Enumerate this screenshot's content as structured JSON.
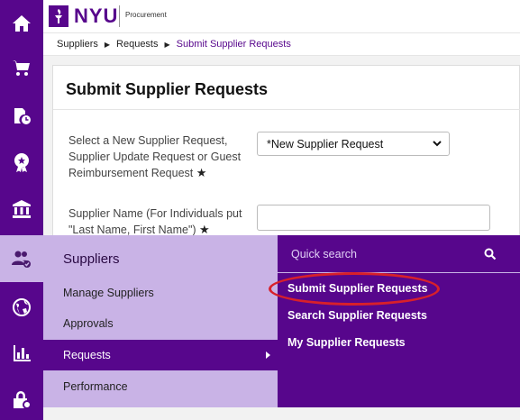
{
  "header": {
    "logo_text": "NYU",
    "app_name": "Procurement"
  },
  "breadcrumb": {
    "items": [
      "Suppliers",
      "Requests",
      "Submit Supplier Requests"
    ]
  },
  "page": {
    "title": "Submit Supplier Requests",
    "fields": [
      {
        "label_lines": [
          "Select a New Supplier Request,",
          "Supplier Update Request or Guest",
          "Reimbursement Request"
        ],
        "required_mark": "★",
        "control": "select",
        "value": "*New Supplier Request"
      },
      {
        "label_lines": [
          "Supplier Name (For Individuals put",
          "\"Last Name, First Name\")"
        ],
        "required_mark": "★",
        "control": "text",
        "value": ""
      }
    ]
  },
  "rail": {
    "icons": [
      "home-icon",
      "cart-icon",
      "document-clock-icon",
      "award-badge-icon",
      "bank-icon",
      "users-check-icon",
      "globe-icon",
      "bar-chart-icon",
      "lock-gear-icon"
    ],
    "active_index": 5
  },
  "flyout": {
    "heading": "Suppliers",
    "items": [
      "Manage Suppliers",
      "Approvals",
      "Requests",
      "Performance"
    ],
    "active_item": "Requests",
    "quick_search_placeholder": "Quick search",
    "submenu": [
      "Submit Supplier Requests",
      "Search Supplier Requests",
      "My Supplier Requests"
    ],
    "highlighted_submenu": "Submit Supplier Requests"
  },
  "colors": {
    "brand_purple": "#57068c",
    "light_purple": "#c9b3e6",
    "highlight_red": "#d8202a"
  }
}
